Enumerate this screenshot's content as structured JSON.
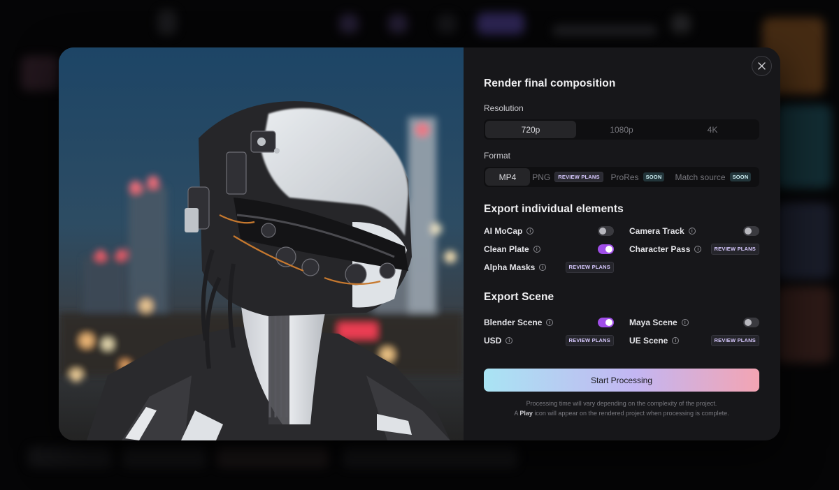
{
  "modal": {
    "title": "Render final composition",
    "resolution": {
      "label": "Resolution",
      "options": [
        "720p",
        "1080p",
        "4K"
      ],
      "selected": "720p"
    },
    "format": {
      "label": "Format",
      "options": [
        {
          "label": "MP4",
          "badge": ""
        },
        {
          "label": "PNG",
          "badge": "REVIEW PLANS"
        },
        {
          "label": "ProRes",
          "badge": "SOON"
        },
        {
          "label": "Match source",
          "badge": "SOON"
        }
      ],
      "selected": "MP4"
    },
    "elements": {
      "title": "Export individual elements",
      "items": [
        {
          "label": "AI MoCap",
          "state": "off"
        },
        {
          "label": "Camera Track",
          "state": "off"
        },
        {
          "label": "Clean Plate",
          "state": "on"
        },
        {
          "label": "Character Pass",
          "badge": "REVIEW PLANS"
        },
        {
          "label": "Alpha Masks",
          "badge": "REVIEW PLANS"
        }
      ]
    },
    "scene": {
      "title": "Export Scene",
      "items": [
        {
          "label": "Blender Scene",
          "state": "on"
        },
        {
          "label": "Maya Scene",
          "state": "off"
        },
        {
          "label": "USD",
          "badge": "REVIEW PLANS"
        },
        {
          "label": "UE Scene",
          "badge": "REVIEW PLANS"
        }
      ]
    },
    "cta_label": "Start Processing",
    "footnote_line1": "Processing time will vary depending on the complexity of the project.",
    "footnote_line2_pre": "A ",
    "footnote_line2_bold": "Play",
    "footnote_line2_post": " icon will appear on the rendered project when processing is complete."
  },
  "colors": {
    "accent_toggle": "#a04ee8",
    "cta_gradient": [
      "#a9e4f3",
      "#c3b6f2",
      "#f3a4b3"
    ]
  },
  "icons": {
    "close": "close-icon",
    "info": "info-icon"
  }
}
